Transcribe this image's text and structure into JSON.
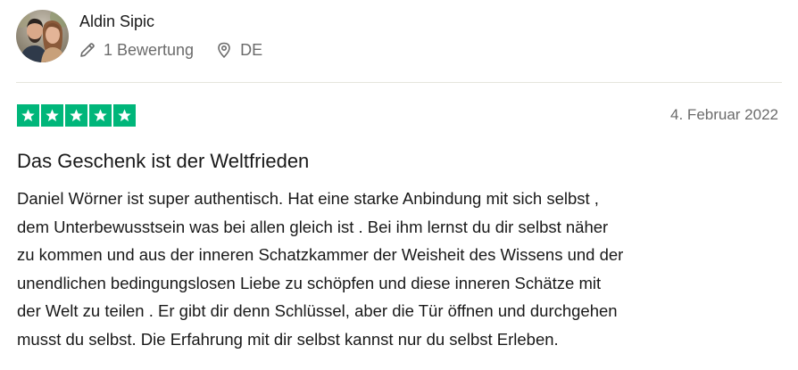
{
  "reviewer": {
    "name": "Aldin Sipic",
    "review_count": "1 Bewertung",
    "country": "DE"
  },
  "review": {
    "rating": 5,
    "rating_max": 5,
    "star_color": "#00b67a",
    "date": "4. Februar 2022",
    "title": "Das Geschenk ist der Weltfrieden",
    "body_lines": [
      "Daniel Wörner ist super authentisch. Hat eine starke Anbindung mit sich selbst ,",
      "dem Unterbewusstsein was bei allen gleich ist . Bei ihm lernst du dir selbst näher",
      "zu kommen und aus der inneren Schatzkammer der Weisheit des Wissens und der",
      "unendlichen bedingungslosen Liebe zu schöpfen und diese inneren Schätze mit",
      "der Welt zu teilen . Er gibt dir denn Schlüssel, aber die Tür öffnen und durchgehen",
      "musst du selbst. Die Erfahrung mit dir selbst kannst nur du selbst Erleben."
    ]
  },
  "icons": {
    "review_count_icon": "pencil-icon",
    "country_icon": "location-pin-icon",
    "rating_icon": "star-icon"
  }
}
